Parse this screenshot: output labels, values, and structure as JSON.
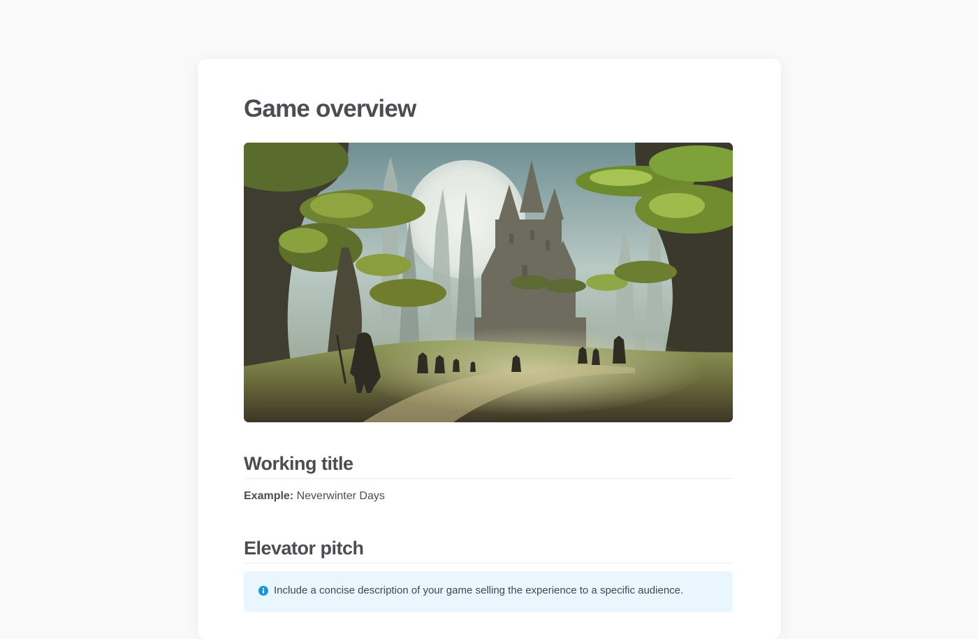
{
  "page": {
    "title": "Game overview"
  },
  "hero_image": {
    "alt": "Fantasy landscape illustration"
  },
  "sections": {
    "working_title": {
      "heading": "Working title",
      "example_label": "Example:",
      "example_value": "Neverwinter Days"
    },
    "elevator_pitch": {
      "heading": "Elevator pitch",
      "callout_text": "Include a concise description of your game selling the experience to a specific audience.",
      "callout_icon": "info-icon"
    }
  },
  "colors": {
    "background": "#f9f9f9",
    "card": "#ffffff",
    "heading": "#4a4d52",
    "callout_bg": "#e9f6fd",
    "info_accent": "#1e97d5"
  }
}
